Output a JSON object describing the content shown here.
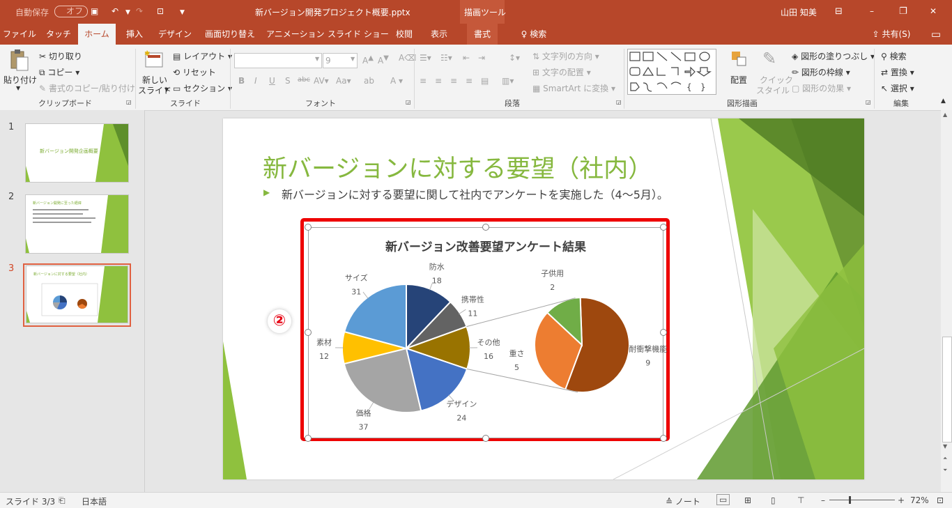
{
  "titlebar": {
    "autosave_label": "自動保存",
    "autosave_toggle": "オフ",
    "file_name": "新バージョン開発プロジェクト概要.pptx",
    "context_tool": "描画ツール",
    "user_name": "山田 知美"
  },
  "tabs": [
    "ファイル",
    "タッチ",
    "ホーム",
    "挿入",
    "デザイン",
    "画面切り替え",
    "アニメーション",
    "スライド ショー",
    "校閲",
    "表示",
    "書式"
  ],
  "active_tab": "ホーム",
  "search_label": "検索",
  "share_label": "共有(S)",
  "ribbon": {
    "clipboard": {
      "paste": "貼り付け",
      "cut": "切り取り",
      "copy": "コピー",
      "format_painter": "書式のコピー/貼り付け",
      "group": "クリップボード"
    },
    "slides": {
      "new_slide_1": "新しい",
      "new_slide_2": "スライド",
      "layout": "レイアウト",
      "reset": "リセット",
      "section": "セクション",
      "group": "スライド"
    },
    "font": {
      "size": "9",
      "group": "フォント"
    },
    "paragraph": {
      "text_direction": "文字列の方向",
      "align_text": "文字の配置",
      "smartart": "SmartArt に変換",
      "group": "段落"
    },
    "drawing": {
      "arrange": "配置",
      "quick_styles_1": "クイック",
      "quick_styles_2": "スタイル",
      "fill": "図形の塗りつぶし",
      "outline": "図形の枠線",
      "effects": "図形の効果",
      "group": "図形描画"
    },
    "editing": {
      "find": "検索",
      "replace": "置換",
      "select": "選択",
      "group": "編集"
    }
  },
  "thumbnails": [
    {
      "num": "1",
      "title": "新バージョン開発企画概要"
    },
    {
      "num": "2",
      "title": "新バージョン開発に至った経緯"
    },
    {
      "num": "3",
      "title": "新バージョンに対する要望（社内）"
    }
  ],
  "slide": {
    "title": "新バージョンに対する要望（社内）",
    "bullet": "新バージョンに対する要望に関して社内でアンケートを実施した（4～5月）。",
    "step_marker": "②"
  },
  "chart_data": {
    "type": "pie",
    "title": "新バージョン改善要望アンケート結果",
    "slices": [
      {
        "label": "防水",
        "value": 18,
        "color": "#264478"
      },
      {
        "label": "携帯性",
        "value": 11,
        "color": "#636363"
      },
      {
        "label": "その他",
        "value": 16,
        "color": "#997300"
      },
      {
        "label": "デザイン",
        "value": 24,
        "color": "#4472c4"
      },
      {
        "label": "価格",
        "value": 37,
        "color": "#a5a5a5"
      },
      {
        "label": "素材",
        "value": 12,
        "color": "#ffc000"
      },
      {
        "label": "サイズ",
        "value": 31,
        "color": "#5b9bd5"
      }
    ],
    "subpie_of": "その他",
    "subslices": [
      {
        "label": "耐衝撃機能",
        "value": 9,
        "color": "#9e480e"
      },
      {
        "label": "重さ",
        "value": 5,
        "color": "#ed7d31"
      },
      {
        "label": "子供用",
        "value": 2,
        "color": "#70ad47"
      }
    ]
  },
  "statusbar": {
    "slide_info": "スライド 3/3",
    "language": "日本語",
    "notes": "ノート",
    "zoom": "72%"
  }
}
